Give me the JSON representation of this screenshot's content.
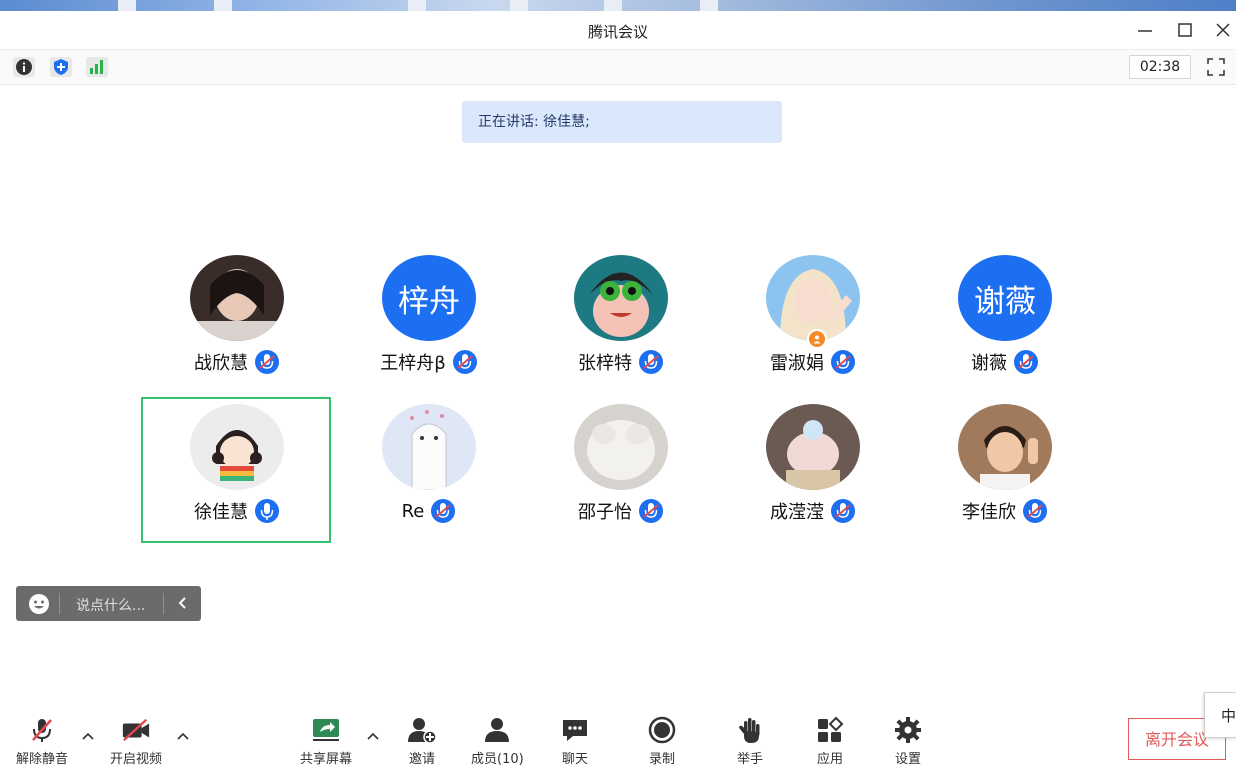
{
  "window": {
    "title": "腾讯会议"
  },
  "top_toolbar": {
    "timer": "02:38"
  },
  "speaker_banner": {
    "text": "正在讲话: 徐佳慧;"
  },
  "participants": [
    {
      "name": "战欣慧",
      "avatar": "photo",
      "mic": "muted"
    },
    {
      "name": "王梓舟β",
      "avatar": "initials",
      "initials": "梓舟",
      "mic": "muted"
    },
    {
      "name": "张梓特",
      "avatar": "cartoon",
      "mic": "muted"
    },
    {
      "name": "雷淑娟",
      "avatar": "photo",
      "mic": "muted",
      "host": true
    },
    {
      "name": "谢薇",
      "avatar": "initials",
      "initials": "谢薇",
      "mic": "muted"
    },
    {
      "name": "徐佳慧",
      "avatar": "cartoon",
      "mic": "speaking"
    },
    {
      "name": "Re",
      "avatar": "cartoon",
      "mic": "muted"
    },
    {
      "name": "邵子怡",
      "avatar": "photo",
      "mic": "muted"
    },
    {
      "name": "成滢滢",
      "avatar": "photo",
      "mic": "muted"
    },
    {
      "name": "李佳欣",
      "avatar": "photo",
      "mic": "muted"
    }
  ],
  "chat_input": {
    "placeholder": "说点什么..."
  },
  "bottom_bar": {
    "unmute": "解除静音",
    "start_video": "开启视频",
    "share_screen": "共享屏幕",
    "invite": "邀请",
    "members": "成员(10)",
    "chat": "聊天",
    "record": "录制",
    "raise_hand": "举手",
    "apps": "应用",
    "settings": "设置",
    "leave": "离开会议"
  },
  "ime_indicator": "中",
  "colors": {
    "accent": "#1d6ff2",
    "active_border": "#34c26d",
    "leave": "#e05a5a",
    "banner": "#dbe8fb"
  }
}
